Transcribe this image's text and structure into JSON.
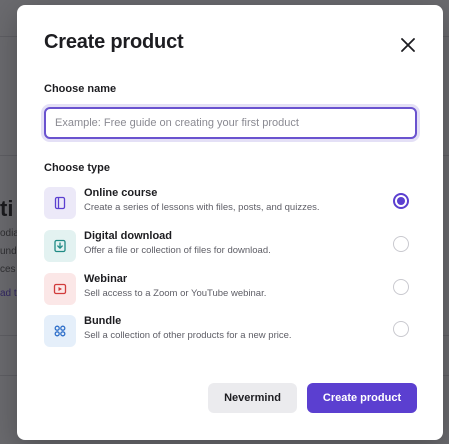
{
  "background": {
    "heading_fragment": "ti",
    "text_lines": [
      "odia",
      "undl",
      "ces"
    ],
    "link_fragment": "ad t"
  },
  "modal": {
    "title": "Create product",
    "close_icon": "close-icon",
    "name_section": {
      "label": "Choose name",
      "value": "",
      "placeholder": "Example: Free guide on creating your first product"
    },
    "type_section": {
      "label": "Choose type",
      "options": [
        {
          "title": "Online course",
          "description": "Create a series of lessons with files, posts, and quizzes.",
          "icon": "book-icon",
          "icon_bg": "#ece9f8",
          "icon_color": "#5b3fd0",
          "selected": true
        },
        {
          "title": "Digital download",
          "description": "Offer a file or collection of files for download.",
          "icon": "download-icon",
          "icon_bg": "#e3f2f1",
          "icon_color": "#1f8a84",
          "selected": false
        },
        {
          "title": "Webinar",
          "description": "Sell access to a Zoom or YouTube webinar.",
          "icon": "video-icon",
          "icon_bg": "#fbe7e7",
          "icon_color": "#d13b3b",
          "selected": false
        },
        {
          "title": "Bundle",
          "description": "Sell a collection of other products for a new price.",
          "icon": "grid-icon",
          "icon_bg": "#e5effa",
          "icon_color": "#2f6fc9",
          "selected": false
        }
      ]
    },
    "actions": {
      "cancel_label": "Nevermind",
      "submit_label": "Create product"
    }
  },
  "colors": {
    "accent": "#5b3fd0",
    "overlay": "#8f8f93"
  }
}
